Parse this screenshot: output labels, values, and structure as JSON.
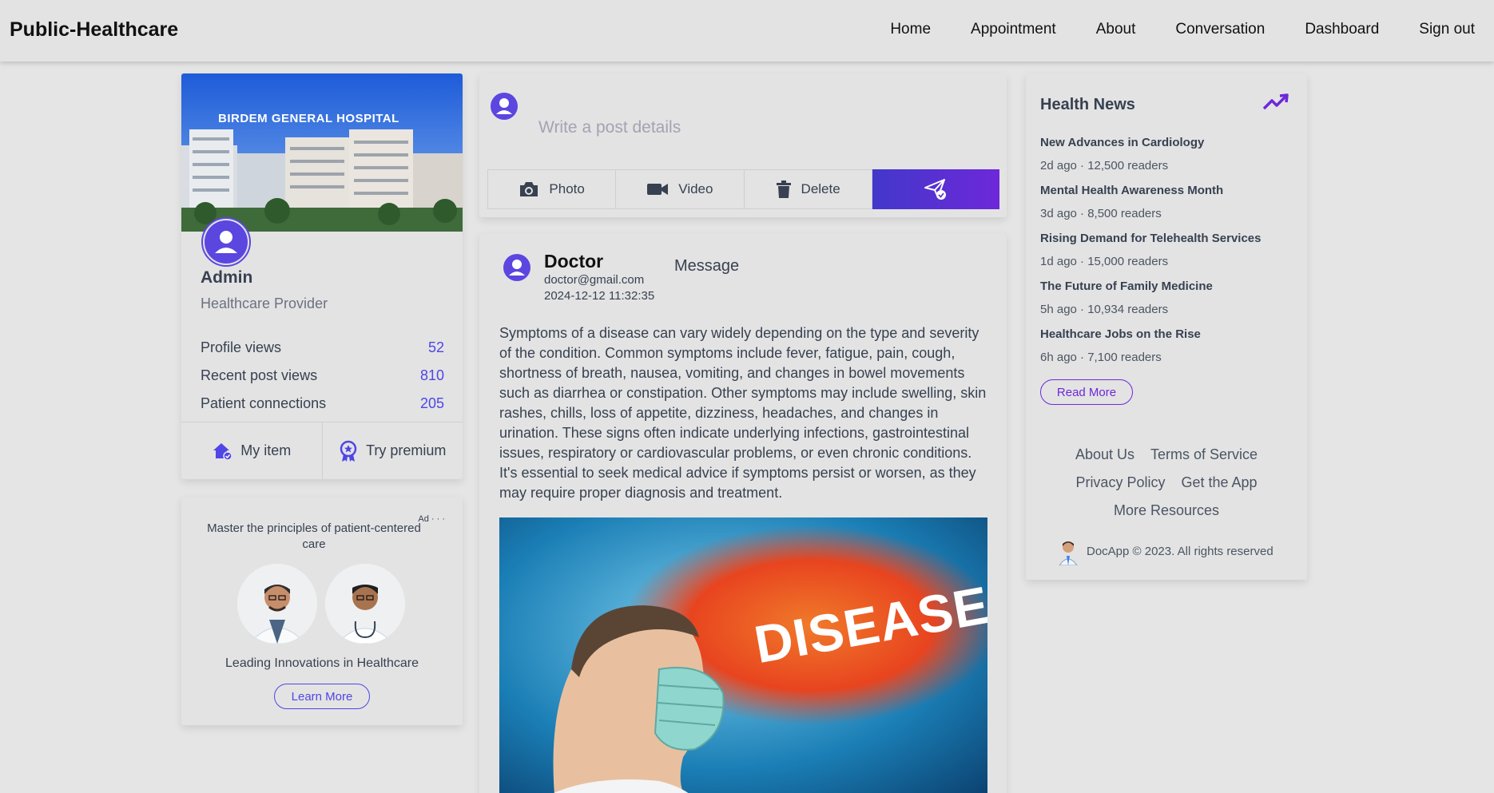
{
  "header": {
    "brand": "Public-Healthcare",
    "nav": [
      "Home",
      "Appointment",
      "About",
      "Conversation",
      "Dashboard",
      "Sign out"
    ]
  },
  "profile": {
    "cover_text": "BIRDEM GENERAL HOSPITAL",
    "name": "Admin",
    "role": "Healthcare Provider",
    "stats": [
      {
        "label": "Profile views",
        "value": "52"
      },
      {
        "label": "Recent post views",
        "value": "810"
      },
      {
        "label": "Patient connections",
        "value": "205"
      }
    ],
    "actions": {
      "my_item": "My item",
      "try_premium": "Try premium"
    }
  },
  "ad": {
    "tag": "Ad · · ·",
    "title": "Master the principles of patient-centered care",
    "subtitle": "Leading Innovations in Healthcare",
    "button": "Learn More"
  },
  "composer": {
    "placeholder": "Write a post details",
    "photo": "Photo",
    "video": "Video",
    "delete": "Delete"
  },
  "post": {
    "author": "Doctor",
    "email": "doctor@gmail.com",
    "timestamp": "2024-12-12 11:32:35",
    "message_label": "Message",
    "body": "Symptoms of a disease can vary widely depending on the type and severity of the condition. Common symptoms include fever, fatigue, pain, cough, shortness of breath, nausea, vomiting, and changes in bowel movements such as diarrhea or constipation. Other symptoms may include swelling, skin rashes, chills, loss of appetite, dizziness, headaches, and changes in urination. These signs often indicate underlying infections, gastrointestinal issues, respiratory or cardiovascular problems, or even chronic conditions. It's essential to seek medical advice if symptoms persist or worsen, as they may require proper diagnosis and treatment.",
    "image_text": "DISEASE"
  },
  "news": {
    "title": "Health News",
    "items": [
      {
        "headline": "New Advances in Cardiology",
        "meta": "2d ago · 12,500 readers"
      },
      {
        "headline": "Mental Health Awareness Month",
        "meta": "3d ago · 8,500 readers"
      },
      {
        "headline": "Rising Demand for Telehealth Services",
        "meta": "1d ago · 15,000 readers"
      },
      {
        "headline": "The Future of Family Medicine",
        "meta": "5h ago · 10,934 readers"
      },
      {
        "headline": "Healthcare Jobs on the Rise",
        "meta": "6h ago · 7,100 readers"
      }
    ],
    "read_more": "Read More"
  },
  "footer": {
    "links": [
      "About Us",
      "Terms of Service",
      "Privacy Policy",
      "Get the App",
      "More Resources"
    ],
    "copyright": "DocApp © 2023. All rights reserved"
  },
  "colors": {
    "accent": "#4f46e5",
    "accent_purple": "#6d28d9",
    "background": "#e5e5e5"
  }
}
